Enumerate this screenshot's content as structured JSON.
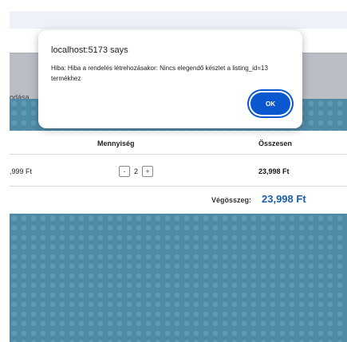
{
  "nav": {
    "partial_label": "odása"
  },
  "cart": {
    "headers": {
      "price": "",
      "quantity": "Mennyiség",
      "total": "Összesen"
    },
    "rows": [
      {
        "price": ",999 Ft",
        "quantity": "2",
        "decrement_label": "-",
        "increment_label": "+",
        "total": "23,998 Ft"
      }
    ],
    "grand_total_label": "Végösszeg:",
    "grand_total_value": "23,998 Ft"
  },
  "dialog": {
    "title": "localhost:5173 says",
    "message": "Hiba: Hiba a rendelés létrehozásakor: Nincs elegendő készlet a listing_id=13 termékhez",
    "ok_label": "OK"
  },
  "colors": {
    "accent": "#0b57d0",
    "total_blue": "#1a5ea8",
    "background": "#4f8ba5"
  }
}
